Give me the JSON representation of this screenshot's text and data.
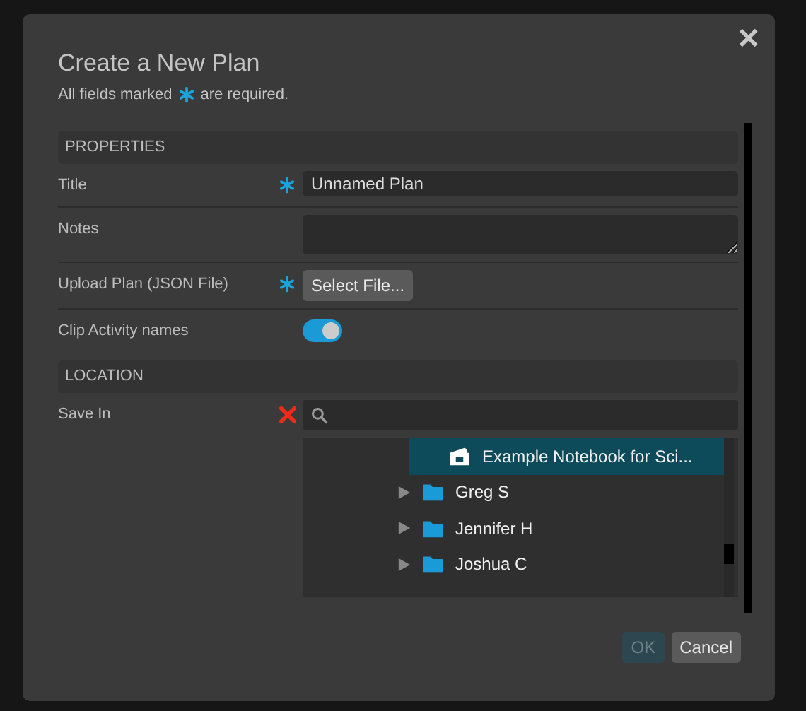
{
  "dialog": {
    "title": "Create a New Plan",
    "required_note_before": "All fields marked",
    "required_note_after": "are required.",
    "close": "✕"
  },
  "sections": [
    {
      "heading": "PROPERTIES"
    },
    {
      "heading": "LOCATION"
    }
  ],
  "fields": [
    {
      "kind": "text",
      "label": "Title",
      "required": true,
      "value": "Unnamed Plan"
    },
    {
      "kind": "textarea",
      "label": "Notes",
      "required": false
    },
    {
      "kind": "file",
      "label": "Upload Plan (JSON File)",
      "required": true,
      "button": "Select File..."
    },
    {
      "kind": "toggle",
      "label": "Clip Activity names",
      "on": true
    }
  ],
  "save_in": {
    "label": "Save In",
    "invalid": true,
    "tree": {
      "hidden_parent_children": [
        {
          "kind": "notebook",
          "label": "Example Notebook for Sci...",
          "selected": true
        }
      ],
      "items": [
        {
          "kind": "folder",
          "label": "Greg S",
          "expanded": false,
          "selected": false
        },
        {
          "kind": "folder",
          "label": "Jennifer H",
          "expanded": false,
          "selected": false
        },
        {
          "kind": "folder",
          "label": "Joshua C",
          "expanded": false,
          "selected": false
        }
      ]
    }
  },
  "buttons": [
    {
      "label": "OK",
      "disabled": true
    },
    {
      "label": "Cancel",
      "disabled": false
    }
  ]
}
